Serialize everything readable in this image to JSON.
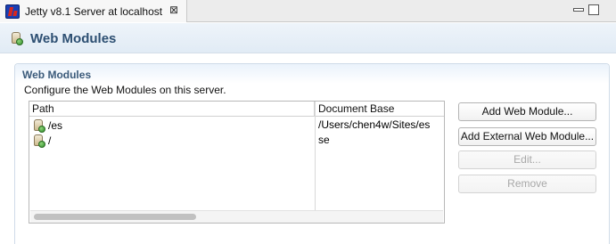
{
  "tab": {
    "title": "Jetty v8.1 Server at localhost",
    "close_glyph": "⊠",
    "icon": "jetty-server-icon"
  },
  "header": {
    "title": "Web Modules",
    "icon": "web-module-icon"
  },
  "section": {
    "title": "Web Modules",
    "description": "Configure the Web Modules on this server."
  },
  "table": {
    "columns": [
      "Path",
      "Document Base"
    ],
    "rows": [
      {
        "path": "/es",
        "document_base": "/Users/chen4w/Sites/es"
      },
      {
        "path": "/",
        "document_base": "se"
      }
    ],
    "horizontal_scroll": 0.39
  },
  "buttons": {
    "add": "Add Web Module...",
    "add_external": "Add External Web Module...",
    "edit": "Edit...",
    "remove": "Remove"
  },
  "colors": {
    "header_title": "#2d4f72",
    "section_title": "#3b5a7a"
  }
}
